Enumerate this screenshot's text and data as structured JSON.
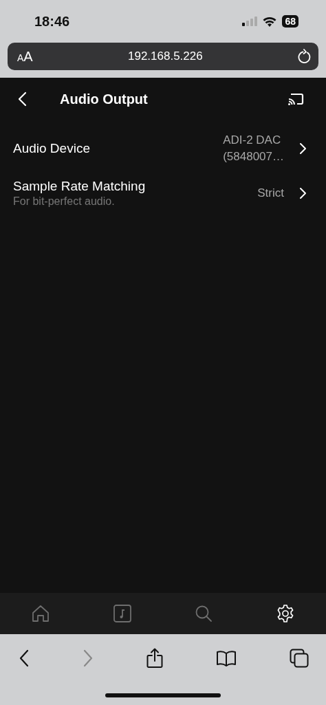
{
  "status_bar": {
    "time": "18:46",
    "battery": "68"
  },
  "address_bar": {
    "text_size": "AA",
    "url": "192.168.5.226"
  },
  "header": {
    "title": "Audio Output"
  },
  "settings": [
    {
      "label": "Audio Device",
      "value_lines": [
        "ADI-2 DAC",
        "(5848007…"
      ]
    },
    {
      "label": "Sample Rate Matching",
      "subtitle": "For bit-perfect audio.",
      "value_lines": [
        "Strict"
      ]
    }
  ],
  "tabs": [
    {
      "kind": "home",
      "selected": false
    },
    {
      "kind": "music",
      "selected": false
    },
    {
      "kind": "search",
      "selected": false
    },
    {
      "kind": "settings",
      "selected": true
    }
  ],
  "browser_toolbar": {
    "back_disabled": false,
    "forward_disabled": true
  }
}
